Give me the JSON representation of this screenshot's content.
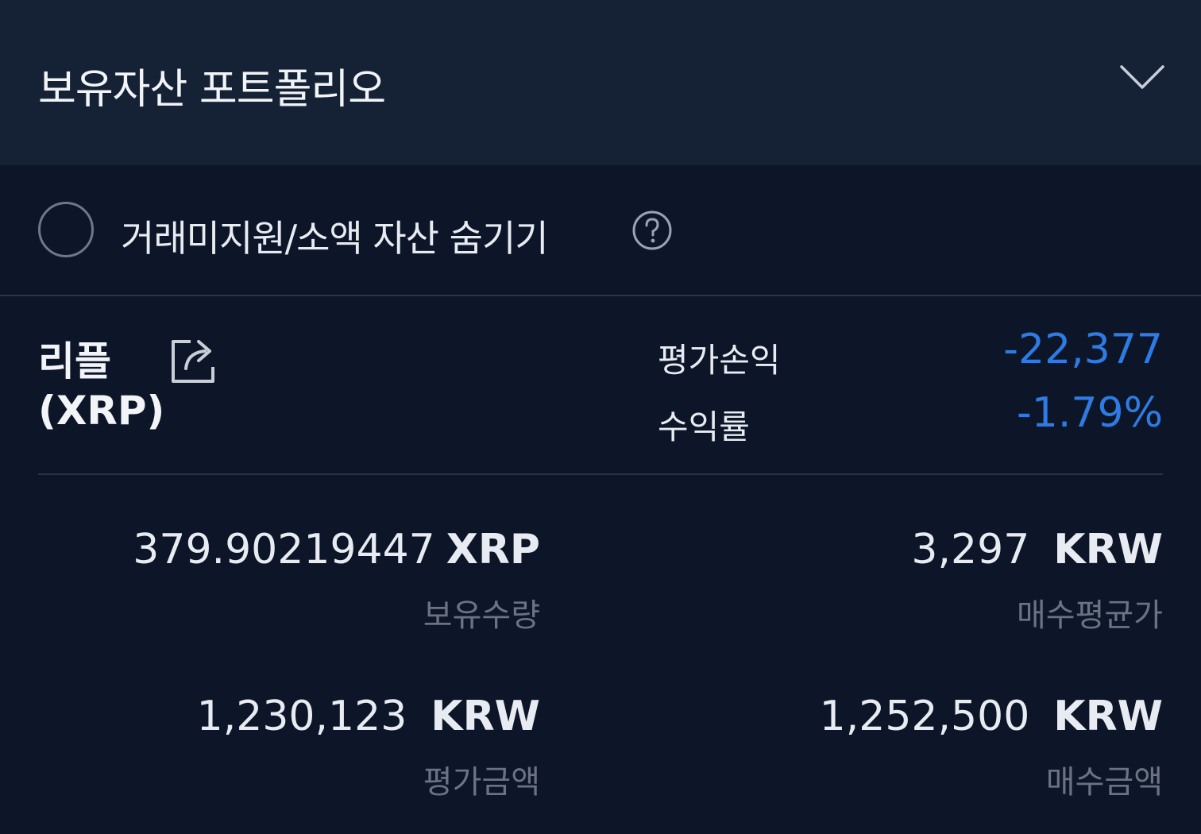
{
  "header": {
    "title": "보유자산 포트폴리오",
    "chevron_icon": "chevron-down-icon"
  },
  "filter": {
    "hide_label": "거래미지원/소액 자산 숨기기",
    "checked": false,
    "help_icon": "question-circle-icon"
  },
  "asset": {
    "name": "리플",
    "symbol": "(XRP)",
    "share_icon": "share-icon",
    "pl_label": "평가손익",
    "pl_value": "-22,377",
    "rate_label": "수익률",
    "rate_value": "-1.79%",
    "negative_color": "#2e7be4"
  },
  "stats": {
    "holding_qty": {
      "value": "379.90219447",
      "unit": "XRP",
      "label": "보유수량"
    },
    "avg_price": {
      "value": "3,297",
      "unit": "KRW",
      "label": "매수평균가"
    },
    "eval_amount": {
      "value": "1,230,123",
      "unit": "KRW",
      "label": "평가금액"
    },
    "buy_amount": {
      "value": "1,252,500",
      "unit": "KRW",
      "label": "매수금액"
    }
  }
}
